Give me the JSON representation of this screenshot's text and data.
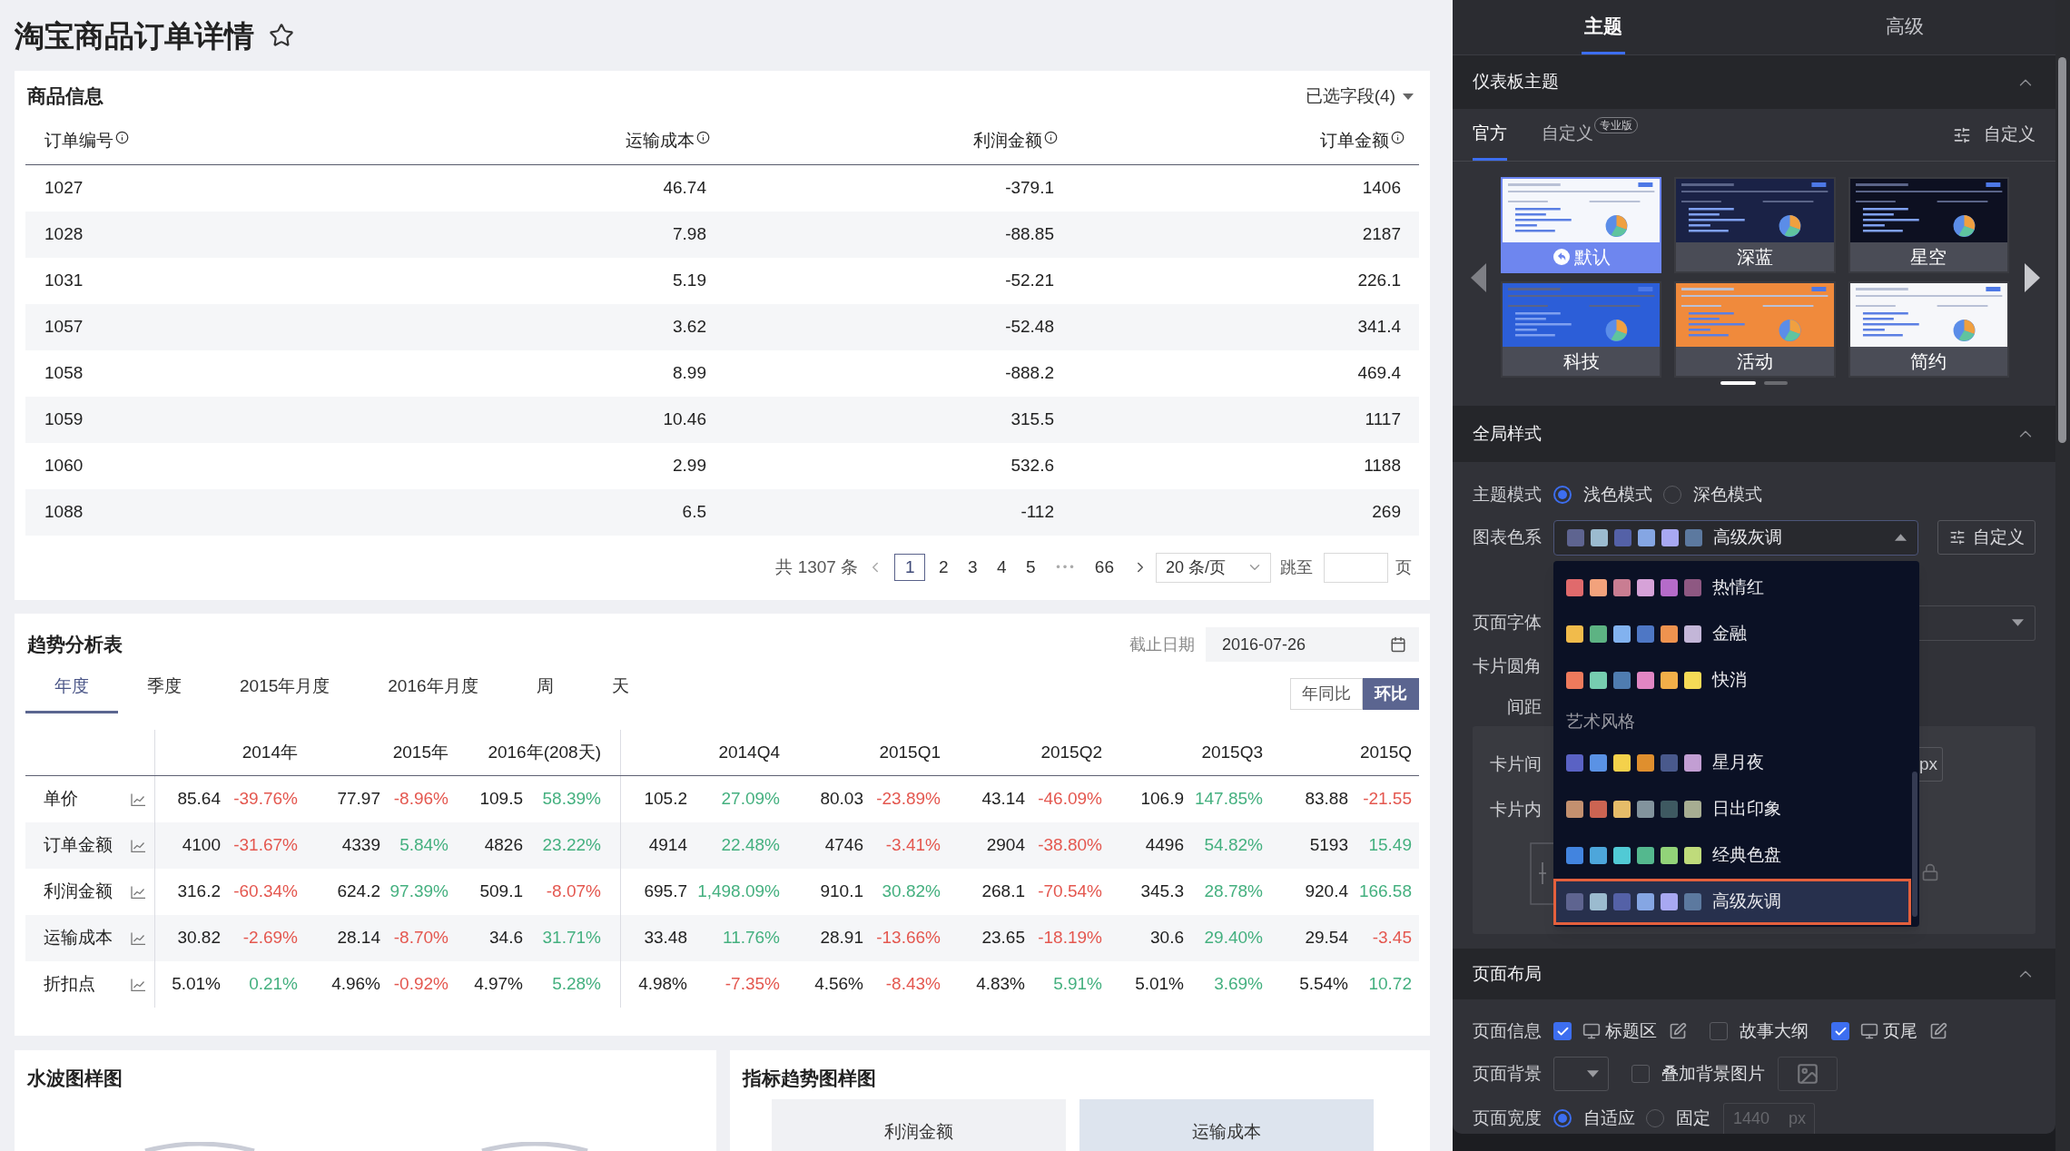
{
  "page": {
    "title": "淘宝商品订单详情",
    "starred": false
  },
  "order_table": {
    "title": "商品信息",
    "field_picker": "已选字段(4)",
    "columns": [
      "订单编号",
      "运输成本",
      "利润金额",
      "订单金额"
    ],
    "rows": [
      [
        "1027",
        "46.74",
        "-379.1",
        "1406"
      ],
      [
        "1028",
        "7.98",
        "-88.85",
        "2187"
      ],
      [
        "1031",
        "5.19",
        "-52.21",
        "226.1"
      ],
      [
        "1057",
        "3.62",
        "-52.48",
        "341.4"
      ],
      [
        "1058",
        "8.99",
        "-888.2",
        "469.4"
      ],
      [
        "1059",
        "10.46",
        "315.5",
        "1117"
      ],
      [
        "1060",
        "2.99",
        "532.6",
        "1188"
      ],
      [
        "1088",
        "6.5",
        "-112",
        "269"
      ]
    ],
    "pagination": {
      "total": "共 1307 条",
      "pages": [
        {
          "kind": "page",
          "label": "1",
          "selected": true
        },
        {
          "kind": "page",
          "label": "2",
          "selected": false
        },
        {
          "kind": "page",
          "label": "3",
          "selected": false
        },
        {
          "kind": "page",
          "label": "4",
          "selected": false
        },
        {
          "kind": "page",
          "label": "5",
          "selected": false
        },
        {
          "kind": "ellipsis",
          "label": "•••",
          "selected": false
        },
        {
          "kind": "page",
          "label": "66",
          "selected": false
        }
      ],
      "page_size": "20 条/页",
      "jump_label": "跳至",
      "jump_suffix": "页"
    }
  },
  "trend_table": {
    "title": "趋势分析表",
    "date_label": "截止日期",
    "date_value": "2016-07-26",
    "tabs": [
      {
        "label": "年度",
        "selected": true
      },
      {
        "label": "季度",
        "selected": false
      },
      {
        "label": "2015年月度",
        "selected": false
      },
      {
        "label": "2016年月度",
        "selected": false
      },
      {
        "label": "周",
        "selected": false
      },
      {
        "label": "天",
        "selected": false
      }
    ],
    "compare_modes": [
      {
        "label": "年同比",
        "selected": false
      },
      {
        "label": "环比",
        "selected": true
      }
    ],
    "column_groups": [
      [
        "2014年",
        "2015年",
        "2016年(208天)"
      ],
      [
        "2014Q4",
        "2015Q1",
        "2015Q2",
        "2015Q3",
        "2015Q"
      ]
    ],
    "rows": [
      {
        "label": "单价",
        "groups": [
          [
            {
              "value": "85.64",
              "change": "-39.76%",
              "color": "#e4574f"
            },
            {
              "value": "77.97",
              "change": "-8.96%",
              "color": "#e4574f"
            },
            {
              "value": "109.5",
              "change": "58.39%",
              "color": "#44b07f"
            }
          ],
          [
            {
              "value": "105.2",
              "change": "27.09%",
              "color": "#44b07f"
            },
            {
              "value": "80.03",
              "change": "-23.89%",
              "color": "#e4574f"
            },
            {
              "value": "43.14",
              "change": "-46.09%",
              "color": "#e4574f"
            },
            {
              "value": "106.9",
              "change": "147.85%",
              "color": "#44b07f"
            },
            {
              "value": "83.88",
              "change": "-21.55",
              "color": "#e4574f"
            }
          ]
        ]
      },
      {
        "label": "订单金额",
        "groups": [
          [
            {
              "value": "4100",
              "change": "-31.67%",
              "color": "#e4574f"
            },
            {
              "value": "4339",
              "change": "5.84%",
              "color": "#44b07f"
            },
            {
              "value": "4826",
              "change": "23.22%",
              "color": "#44b07f"
            }
          ],
          [
            {
              "value": "4914",
              "change": "22.48%",
              "color": "#44b07f"
            },
            {
              "value": "4746",
              "change": "-3.41%",
              "color": "#e4574f"
            },
            {
              "value": "2904",
              "change": "-38.80%",
              "color": "#e4574f"
            },
            {
              "value": "4496",
              "change": "54.82%",
              "color": "#44b07f"
            },
            {
              "value": "5193",
              "change": "15.49",
              "color": "#44b07f"
            }
          ]
        ]
      },
      {
        "label": "利润金额",
        "groups": [
          [
            {
              "value": "316.2",
              "change": "-60.34%",
              "color": "#e4574f"
            },
            {
              "value": "624.2",
              "change": "97.39%",
              "color": "#44b07f"
            },
            {
              "value": "509.1",
              "change": "-8.07%",
              "color": "#e4574f"
            }
          ],
          [
            {
              "value": "695.7",
              "change": "1,498.09%",
              "color": "#44b07f"
            },
            {
              "value": "910.1",
              "change": "30.82%",
              "color": "#44b07f"
            },
            {
              "value": "268.1",
              "change": "-70.54%",
              "color": "#e4574f"
            },
            {
              "value": "345.3",
              "change": "28.78%",
              "color": "#44b07f"
            },
            {
              "value": "920.4",
              "change": "166.58",
              "color": "#44b07f"
            }
          ]
        ]
      },
      {
        "label": "运输成本",
        "groups": [
          [
            {
              "value": "30.82",
              "change": "-2.69%",
              "color": "#e4574f"
            },
            {
              "value": "28.14",
              "change": "-8.70%",
              "color": "#e4574f"
            },
            {
              "value": "34.6",
              "change": "31.71%",
              "color": "#44b07f"
            }
          ],
          [
            {
              "value": "33.48",
              "change": "11.76%",
              "color": "#44b07f"
            },
            {
              "value": "28.91",
              "change": "-13.66%",
              "color": "#e4574f"
            },
            {
              "value": "23.65",
              "change": "-18.19%",
              "color": "#e4574f"
            },
            {
              "value": "30.6",
              "change": "29.40%",
              "color": "#44b07f"
            },
            {
              "value": "29.54",
              "change": "-3.45",
              "color": "#e4574f"
            }
          ]
        ]
      },
      {
        "label": "折扣点",
        "groups": [
          [
            {
              "value": "5.01%",
              "change": "0.21%",
              "color": "#44b07f"
            },
            {
              "value": "4.96%",
              "change": "-0.92%",
              "color": "#e4574f"
            },
            {
              "value": "4.97%",
              "change": "5.28%",
              "color": "#44b07f"
            }
          ],
          [
            {
              "value": "4.98%",
              "change": "-7.35%",
              "color": "#e4574f"
            },
            {
              "value": "4.56%",
              "change": "-8.43%",
              "color": "#e4574f"
            },
            {
              "value": "4.83%",
              "change": "5.91%",
              "color": "#44b07f"
            },
            {
              "value": "5.01%",
              "change": "3.69%",
              "color": "#44b07f"
            },
            {
              "value": "5.54%",
              "change": "10.72",
              "color": "#44b07f"
            }
          ]
        ]
      }
    ]
  },
  "wave_card": {
    "title": "水波图样图"
  },
  "trend_card": {
    "title": "指标趋势图样图",
    "metrics": [
      {
        "label": "利润金额",
        "selected": false
      },
      {
        "label": "运输成本",
        "selected": true
      }
    ]
  },
  "settings": {
    "tabs": [
      {
        "label": "主题",
        "selected": true
      },
      {
        "label": "高级",
        "selected": false
      }
    ],
    "dashboard_theme": {
      "title": "仪表板主题",
      "expanded": true,
      "sources": [
        {
          "label": "官方",
          "selected": true
        },
        {
          "label": "自定义",
          "selected": false,
          "badge": "专业版"
        }
      ],
      "custom_button": "自定义",
      "themes": [
        {
          "label": "默认",
          "selected": true,
          "color": "#f5f7fc"
        },
        {
          "label": "深蓝",
          "selected": false,
          "color": "#1a2246"
        },
        {
          "label": "星空",
          "selected": false,
          "color": "#0d1021"
        },
        {
          "label": "科技",
          "selected": false,
          "color": "#2c5ed8"
        },
        {
          "label": "活动",
          "selected": false,
          "color": "#f08a3c"
        },
        {
          "label": "简约",
          "selected": false,
          "color": "#f6f7fa"
        }
      ],
      "carousel_pages": [
        {
          "selected": true
        },
        {
          "selected": false
        }
      ]
    },
    "global_style": {
      "title": "全局样式",
      "expanded": true,
      "theme_mode": {
        "label": "主题模式",
        "options": [
          {
            "label": "浅色模式",
            "selected": true
          },
          {
            "label": "深色模式",
            "selected": false
          }
        ]
      },
      "chart_palette": {
        "label": "图表色系",
        "value": {
          "name": "高级灰调",
          "swatches": [
            {
              "color": "#5e6490"
            },
            {
              "color": "#9bbbcf"
            },
            {
              "color": "#5461a7"
            },
            {
              "color": "#85a6e3"
            },
            {
              "color": "#a8a8f2"
            },
            {
              "color": "#5c799f"
            }
          ]
        },
        "expanded": true,
        "custom_button": "自定义",
        "options": [
          {
            "kind": "palette",
            "name": "热情红",
            "selected": false,
            "swatches": [
              {
                "color": "#e06a6c"
              },
              {
                "color": "#f2a27c"
              },
              {
                "color": "#c97d92"
              },
              {
                "color": "#d6a2d8"
              },
              {
                "color": "#b56bc9"
              },
              {
                "color": "#8e5882"
              }
            ]
          },
          {
            "kind": "palette",
            "name": "金融",
            "selected": false,
            "swatches": [
              {
                "color": "#f1bb4b"
              },
              {
                "color": "#5db383"
              },
              {
                "color": "#82b2ef"
              },
              {
                "color": "#4e77c5"
              },
              {
                "color": "#ef934f"
              },
              {
                "color": "#c3b6d8"
              }
            ]
          },
          {
            "kind": "palette",
            "name": "快消",
            "selected": false,
            "swatches": [
              {
                "color": "#ee7a5c"
              },
              {
                "color": "#76cdb0"
              },
              {
                "color": "#4f7cb0"
              },
              {
                "color": "#e186c3"
              },
              {
                "color": "#f2af49"
              },
              {
                "color": "#f5da56"
              }
            ]
          },
          {
            "kind": "group",
            "name": "艺术风格"
          },
          {
            "kind": "palette",
            "name": "星月夜",
            "selected": false,
            "swatches": [
              {
                "color": "#5a62c4"
              },
              {
                "color": "#5a92e5"
              },
              {
                "color": "#f4d14b"
              },
              {
                "color": "#df8f2e"
              },
              {
                "color": "#49598c"
              },
              {
                "color": "#c29ed3"
              }
            ]
          },
          {
            "kind": "palette",
            "name": "日出印象",
            "selected": false,
            "swatches": [
              {
                "color": "#c3906f"
              },
              {
                "color": "#cc6452"
              },
              {
                "color": "#e6bc69"
              },
              {
                "color": "#82939d"
              },
              {
                "color": "#3e5961"
              },
              {
                "color": "#a7ad92"
              }
            ]
          },
          {
            "kind": "palette",
            "name": "经典色盘",
            "selected": false,
            "swatches": [
              {
                "color": "#4284df"
              },
              {
                "color": "#4da6db"
              },
              {
                "color": "#51cad5"
              },
              {
                "color": "#54b88e"
              },
              {
                "color": "#92d379"
              },
              {
                "color": "#bfdb7b"
              }
            ]
          },
          {
            "kind": "palette",
            "name": "高级灰调",
            "selected": true,
            "swatches": [
              {
                "color": "#5e6490"
              },
              {
                "color": "#9bbbcf"
              },
              {
                "color": "#5461a7"
              },
              {
                "color": "#85a6e3"
              },
              {
                "color": "#a8a8f2"
              },
              {
                "color": "#5c799f"
              }
            ]
          }
        ]
      },
      "font": {
        "label": "页面字体"
      },
      "corner": {
        "label": "卡片圆角"
      },
      "spacing": {
        "label": "间距",
        "card_gap": {
          "label": "卡片间",
          "unit": "px"
        },
        "card_padding": {
          "label": "卡片内"
        }
      }
    },
    "page_layout": {
      "title": "页面布局",
      "expanded": true,
      "page_info": {
        "label": "页面信息",
        "options": [
          {
            "kind": "screen",
            "label": "标题区",
            "checked": true
          },
          {
            "kind": "plain",
            "label": "故事大纲",
            "checked": false
          },
          {
            "kind": "screen",
            "label": "页尾",
            "checked": true
          }
        ]
      },
      "background": {
        "label": "页面背景",
        "overlay": {
          "label": "叠加背景图片",
          "checked": false
        }
      },
      "width": {
        "label": "页面宽度",
        "options": [
          {
            "label": "自适应",
            "selected": true
          },
          {
            "label": "固定",
            "selected": false
          }
        ],
        "input": {
          "placeholder": "1440",
          "unit": "px",
          "disabled": true
        }
      }
    }
  }
}
